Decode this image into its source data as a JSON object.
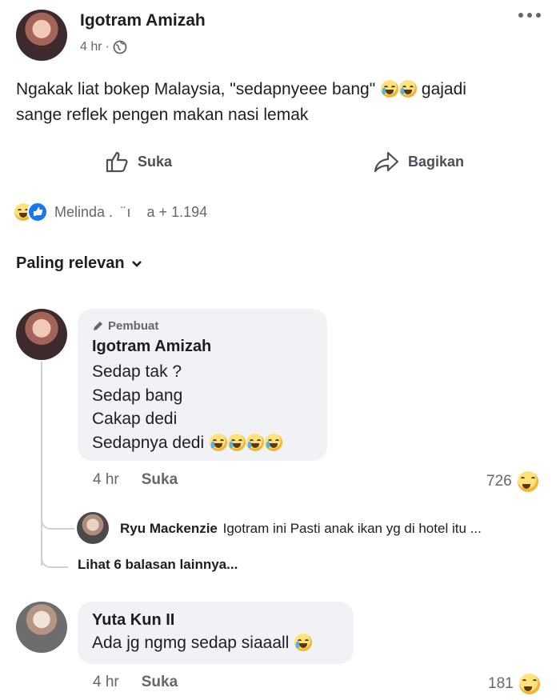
{
  "post": {
    "author": "Igotram Amizah",
    "time": "4 hr",
    "separator": "·",
    "text_line1": "Ngakak liat bokep Malaysia, \"sedapnyeee bang\"",
    "text_line1_end": "gajadi",
    "text_line2": "sange reflek pengen makan nasi lemak",
    "more_icon": "more-dots-icon"
  },
  "actions": {
    "like": "Suka",
    "share": "Bagikan"
  },
  "reactions": {
    "names": "Melinda .  ¨ ı    a + 1.194"
  },
  "sort": {
    "label": "Paling relevan"
  },
  "comments": [
    {
      "badge": "Pembuat",
      "author": "Igotram Amizah",
      "lines": [
        "Sedap tak ?",
        "Sedap bang",
        "Cakap dedi",
        "Sedapnya dedi"
      ],
      "time": "4 hr",
      "like": "Suka",
      "count": "726"
    },
    {
      "author": "Yuta Kun II",
      "lines": [
        "Ada jg ngmg sedap siaaall"
      ],
      "time": "4 hr",
      "like": "Suka",
      "count": "181"
    }
  ],
  "reply": {
    "author": "Ryu Mackenzie",
    "text": "Igotram ini Pasti anak ikan yg di hotel itu ...",
    "more": "Lihat 6 balasan lainnya..."
  }
}
